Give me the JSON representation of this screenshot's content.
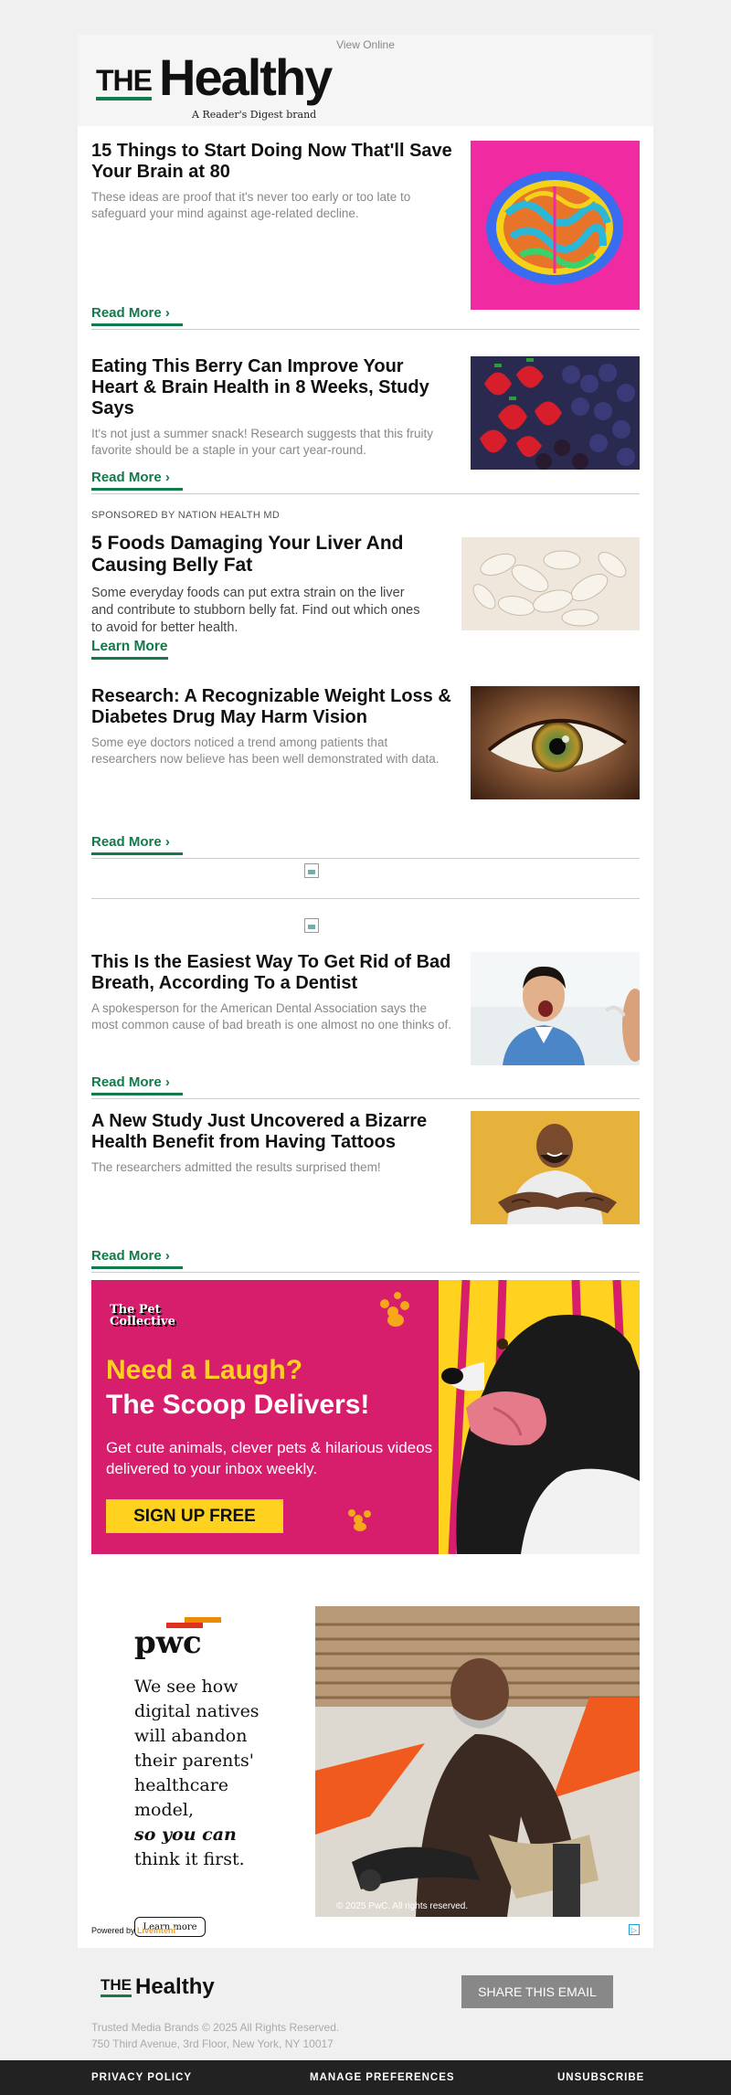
{
  "header": {
    "view_online": "View Online",
    "logo_the": "THE",
    "logo_healthy": "Healthy",
    "logo_sub": "A Reader's Digest brand"
  },
  "articles": [
    {
      "title": "15 Things to Start Doing Now That'll Save Your Brain at 80",
      "desc": "These ideas are proof that it's never too early or too late to safeguard your mind against age-related decline.",
      "cta": "Read More ›"
    },
    {
      "title": "Eating This Berry Can Improve Your Heart & Brain Health in 8 Weeks, Study Says",
      "desc": "It's not just a summer snack! Research suggests that this fruity favorite should be a staple in your cart year-round.",
      "cta": "Read More ›"
    },
    {
      "title": "Research: A Recognizable Weight Loss & Diabetes Drug May Harm Vision",
      "desc": "Some eye doctors noticed a trend among patients that researchers now believe has been well demonstrated with data.",
      "cta": "Read More ›"
    },
    {
      "title": "This Is the Easiest Way To Get Rid of Bad Breath, According To a Dentist",
      "desc": "A spokesperson for the American Dental Association says the most common cause of bad breath is one almost no one thinks of.",
      "cta": "Read More ›"
    },
    {
      "title": "A New Study Just Uncovered a Bizarre Health Benefit from Having Tattoos",
      "desc": "The researchers admitted the results surprised them!",
      "cta": "Read More ›"
    }
  ],
  "sponsored": {
    "label": "SPONSORED BY NATION HEALTH MD",
    "title": "5 Foods Damaging Your Liver And Causing Belly Fat",
    "desc": "Some everyday foods can put extra strain on the liver and contribute to stubborn belly fat. Find out which ones to avoid for better health.",
    "cta": "Learn More"
  },
  "pet_ad": {
    "brand_line1": "The Pet",
    "brand_line2": "Collective",
    "headline1": "Need a Laugh?",
    "headline2": "The Scoop Delivers!",
    "body": "Get cute animals, clever pets & hilarious videos delivered to your inbox weekly.",
    "cta": "SIGN UP FREE",
    "colors": {
      "bg": "#d61e6c",
      "yellow": "#ffd21f"
    }
  },
  "pwc_ad": {
    "brand": "pwc",
    "line1": "We see how",
    "line2": "digital natives",
    "line3": "will abandon",
    "line4": "their parents'",
    "line5": "healthcare",
    "line6": "model,",
    "line7": "so you can",
    "line8": "think it first.",
    "cta": "Learn more",
    "copyright": "© 2025 PwC. All rights reserved.",
    "powered_by": "Powered by",
    "powered_brand": "LiveIntent"
  },
  "footer": {
    "logo_the": "THE",
    "logo_healthy": "Healthy",
    "share": "SHARE THIS EMAIL",
    "company": "Trusted Media Brands © 2025 All Rights Reserved.",
    "address": "750 Third Avenue, 3rd Floor, New York, NY 10017"
  },
  "bottom_links": {
    "privacy": "PRIVACY POLICY",
    "preferences": "MANAGE PREFERENCES",
    "unsubscribe": "UNSUBSCRIBE"
  },
  "colors": {
    "accent": "#137a4a",
    "page_bg": "#f0f0f0"
  }
}
